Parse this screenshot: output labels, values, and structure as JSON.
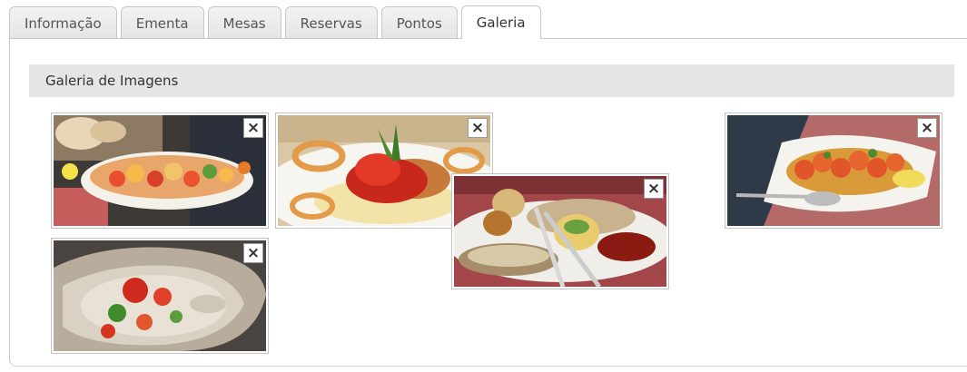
{
  "tabs": [
    {
      "label": "Informação",
      "active": false
    },
    {
      "label": "Ementa",
      "active": false
    },
    {
      "label": "Mesas",
      "active": false
    },
    {
      "label": "Reservas",
      "active": false
    },
    {
      "label": "Pontos",
      "active": false
    },
    {
      "label": "Galeria",
      "active": true
    }
  ],
  "gallery": {
    "title": "Galeria de Imagens",
    "images": [
      {
        "subject": "seafood skewers with bread"
      },
      {
        "subject": "stuffed squid with mashed potato"
      },
      {
        "subject": "oyster with salsa"
      },
      {
        "subject": "grilled fish platter"
      },
      {
        "subject": "shrimp in white dish"
      }
    ],
    "remove_icon": "×"
  },
  "colors": {
    "tab_bg": "#e8e8e8",
    "tab_border": "#c8c8c8",
    "header_bg": "#e6e6e6",
    "text": "#333333"
  }
}
